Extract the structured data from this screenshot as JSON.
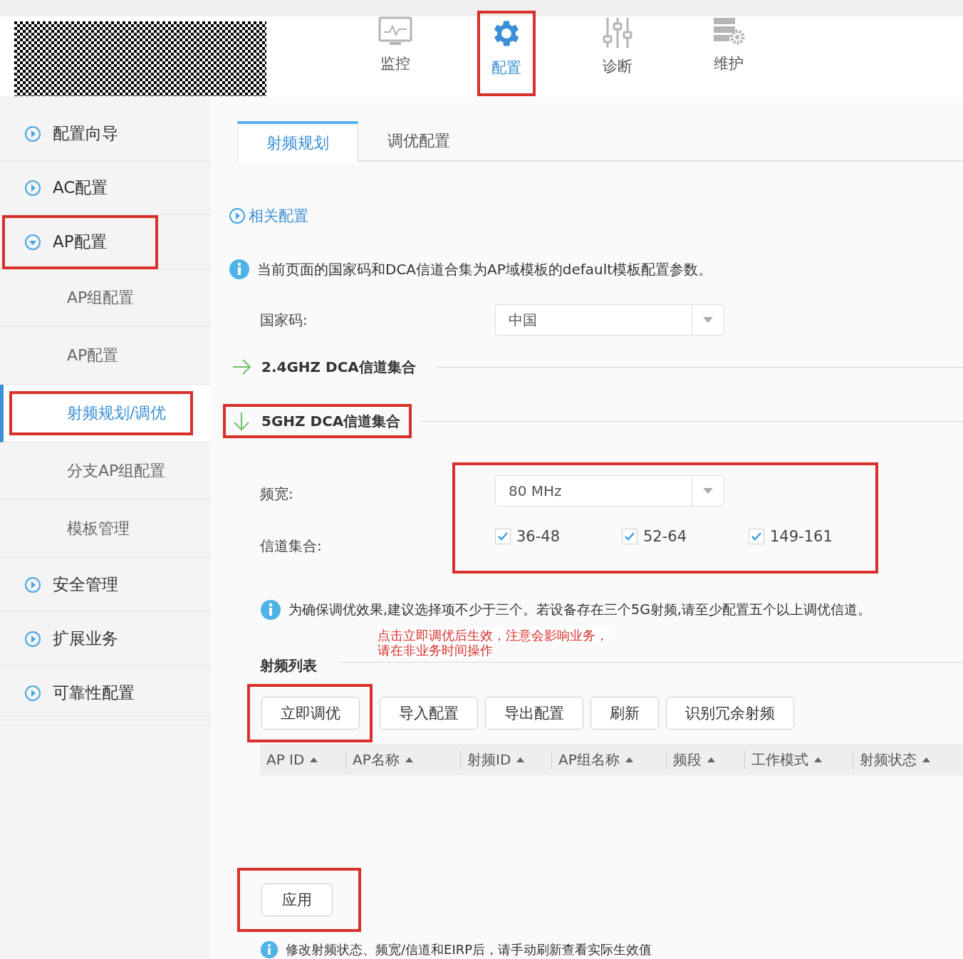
{
  "nav": [
    {
      "label": "监控",
      "selected": false
    },
    {
      "label": "配置",
      "selected": true,
      "annotated": true
    },
    {
      "label": "诊断",
      "selected": false
    },
    {
      "label": "维护",
      "selected": false
    }
  ],
  "sidebar": {
    "items": [
      {
        "label": "配置向导",
        "expanded": false
      },
      {
        "label": "AC配置",
        "expanded": false
      },
      {
        "label": "AP配置",
        "expanded": true,
        "annotated": true,
        "children": [
          {
            "label": "AP组配置",
            "selected": false
          },
          {
            "label": "AP配置",
            "selected": false
          },
          {
            "label": "射频规划/调优",
            "selected": true,
            "annotated": true
          },
          {
            "label": "分支AP组配置",
            "selected": false
          },
          {
            "label": "模板管理",
            "selected": false
          }
        ]
      },
      {
        "label": "安全管理",
        "expanded": false
      },
      {
        "label": "扩展业务",
        "expanded": false
      },
      {
        "label": "可靠性配置",
        "expanded": false
      }
    ]
  },
  "tabs": [
    {
      "label": "射频规划",
      "selected": true
    },
    {
      "label": "调优配置",
      "selected": false
    }
  ],
  "related_link": "相关配置",
  "info": "当前页面的国家码和DCA信道合集为AP域模板的default模板配置参数。",
  "country": {
    "label": "国家码:",
    "value": "中国"
  },
  "sections": [
    {
      "title": "2.4GHZ DCA信道集合",
      "expanded": false
    },
    {
      "title": "5GHZ DCA信道集合",
      "expanded": true,
      "annotated": true
    }
  ],
  "band": {
    "annotated": true,
    "bandwidth_label": "频宽:",
    "bandwidth": "80 MHz",
    "channels_label": "信道集合:",
    "channels": [
      {
        "label": "36-48",
        "checked": true
      },
      {
        "label": "52-64",
        "checked": true
      },
      {
        "label": "149-161",
        "checked": true
      }
    ]
  },
  "tip": "为确保调优效果,建议选择项不少于三个。若设备存在三个5G射频,请至少配置五个以上调优信道。",
  "annotation_note": [
    "点击立即调优后生效，注意会影响业务，",
    "请在非业务时间操作"
  ],
  "radio_list": {
    "title": "射频列表",
    "buttons": [
      {
        "label": "立即调优",
        "annotated": true
      },
      {
        "label": "导入配置"
      },
      {
        "label": "导出配置"
      },
      {
        "label": "刷新"
      },
      {
        "label": "识别冗余射频"
      }
    ],
    "columns": [
      "AP ID",
      "AP名称",
      "射频ID",
      "AP组名称",
      "频段",
      "工作模式",
      "射频状态"
    ]
  },
  "apply": {
    "label": "应用",
    "annotated": true
  },
  "footer_tip": "修改射频状态、频宽/信道和EIRP后，请手动刷新查看实际生效值"
}
